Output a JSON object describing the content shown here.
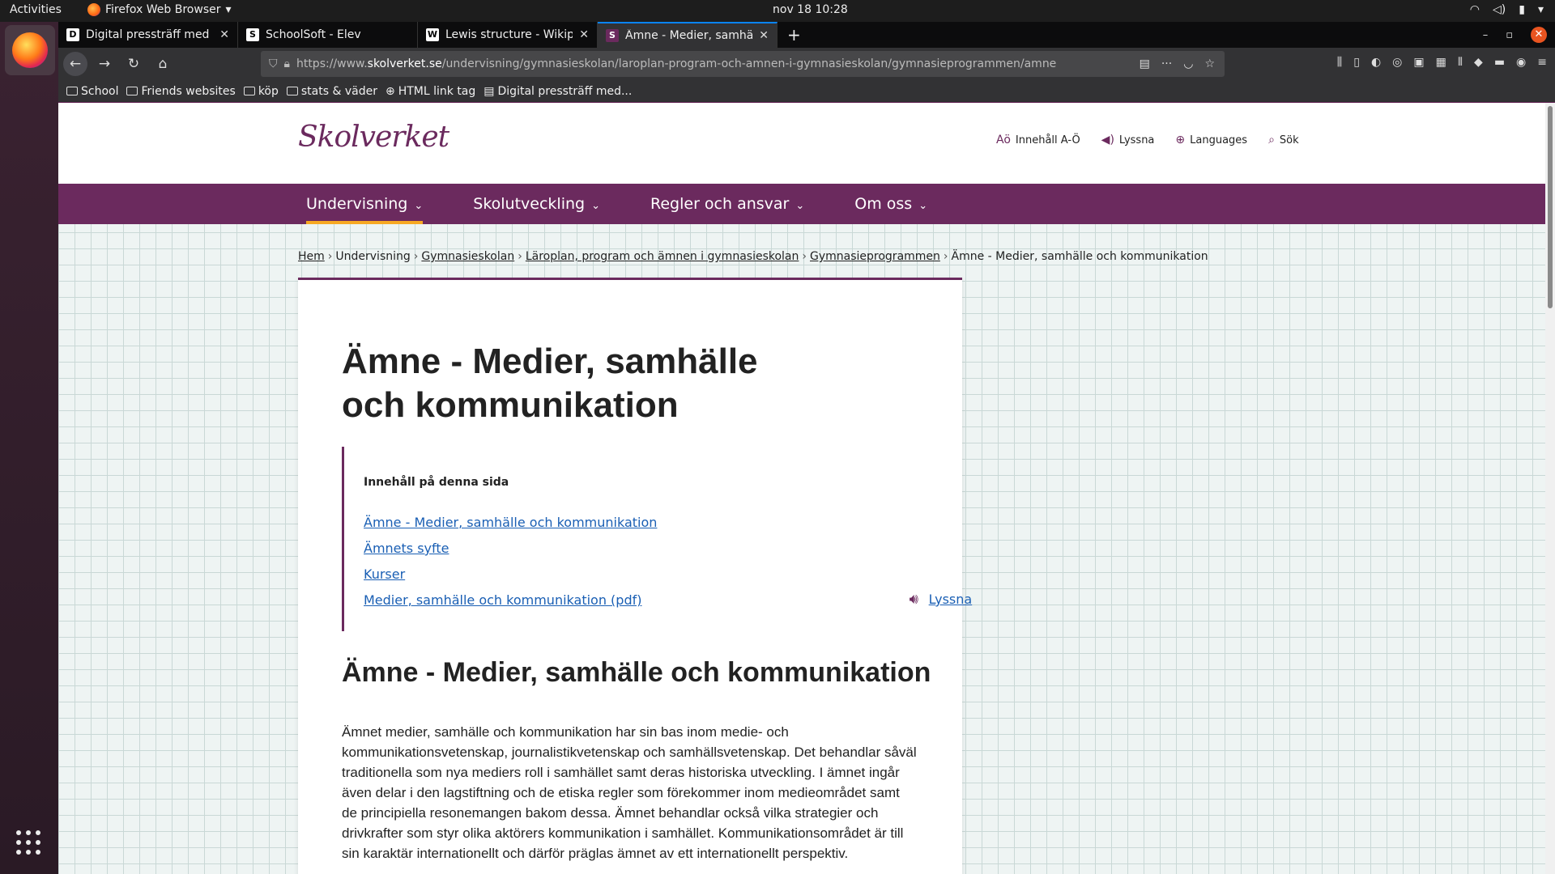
{
  "system": {
    "activities": "Activities",
    "app_name": "Firefox Web Browser",
    "clock": "nov 18  10:28"
  },
  "tabs": [
    {
      "title": "Digital pressträff med ut",
      "favicon": "D"
    },
    {
      "title": "SchoolSoft - Elev",
      "favicon": "S"
    },
    {
      "title": "Lewis structure - Wikipe",
      "favicon": "W"
    },
    {
      "title": "Ämne - Medier, samhälle",
      "favicon": "S"
    }
  ],
  "url": {
    "prefix": "https://www.",
    "domain": "skolverket.se",
    "path": "/undervisning/gymnasieskolan/laroplan-program-och-amnen-i-gymnasieskolan/gymnasieprogrammen/amne"
  },
  "bookmarks": [
    {
      "label": "School",
      "icon": "folder-icon"
    },
    {
      "label": "Friends websites",
      "icon": "folder-icon"
    },
    {
      "label": "köp",
      "icon": "folder-icon"
    },
    {
      "label": "stats & väder",
      "icon": "folder-icon"
    },
    {
      "label": "HTML link tag",
      "icon": "globe-icon"
    },
    {
      "label": "Digital pressträff med...",
      "icon": "page-icon"
    }
  ],
  "site": {
    "logo": "Skolverket",
    "utility": [
      {
        "label": "Innehåll A-Ö",
        "icon": "az-icon"
      },
      {
        "label": "Lyssna",
        "icon": "speaker-icon"
      },
      {
        "label": "Languages",
        "icon": "globe-icon"
      },
      {
        "label": "Sök",
        "icon": "search-icon"
      }
    ],
    "nav": [
      {
        "label": "Undervisning"
      },
      {
        "label": "Skolutveckling"
      },
      {
        "label": "Regler och ansvar"
      },
      {
        "label": "Om oss"
      }
    ]
  },
  "breadcrumb": {
    "items": [
      "Hem",
      "Undervisning",
      "Gymnasieskolan",
      "Läroplan, program och ämnen i gymnasieskolan",
      "Gymnasieprogrammen",
      "Ämne - Medier, samhälle och kommunikation"
    ]
  },
  "content": {
    "title": "Ämne - Medier, samhälle och kommunikation",
    "toc_header": "Innehåll på denna sida",
    "toc": [
      "Ämne - Medier, samhälle och kommunikation",
      "Ämnets syfte",
      "Kurser",
      "Medier, samhälle och kommunikation (pdf)"
    ],
    "listen": "Lyssna",
    "section_title": "Ämne - Medier, samhälle och kommunikation",
    "paragraph": "Ämnet medier, samhälle och kommunikation har sin bas inom medie- och kommunikationsvetenskap, journalistikvetenskap och samhällsvetenskap. Det behandlar såväl traditionella som nya mediers roll i samhället samt deras historiska utveckling. I ämnet ingår även delar i den lagstiftning och de etiska regler som förekommer inom medieområdet samt de principiella resonemangen bakom dessa. Ämnet behandlar också vilka strategier och drivkrafter som styr olika aktörers kommunikation i samhället. Kommunikationsområdet är till sin karaktär internationellt och därför präglas ämnet av ett internationellt perspektiv."
  },
  "colors": {
    "brand": "#6b2a5e",
    "accent": "#f7a823",
    "link": "#1a5fb4"
  }
}
